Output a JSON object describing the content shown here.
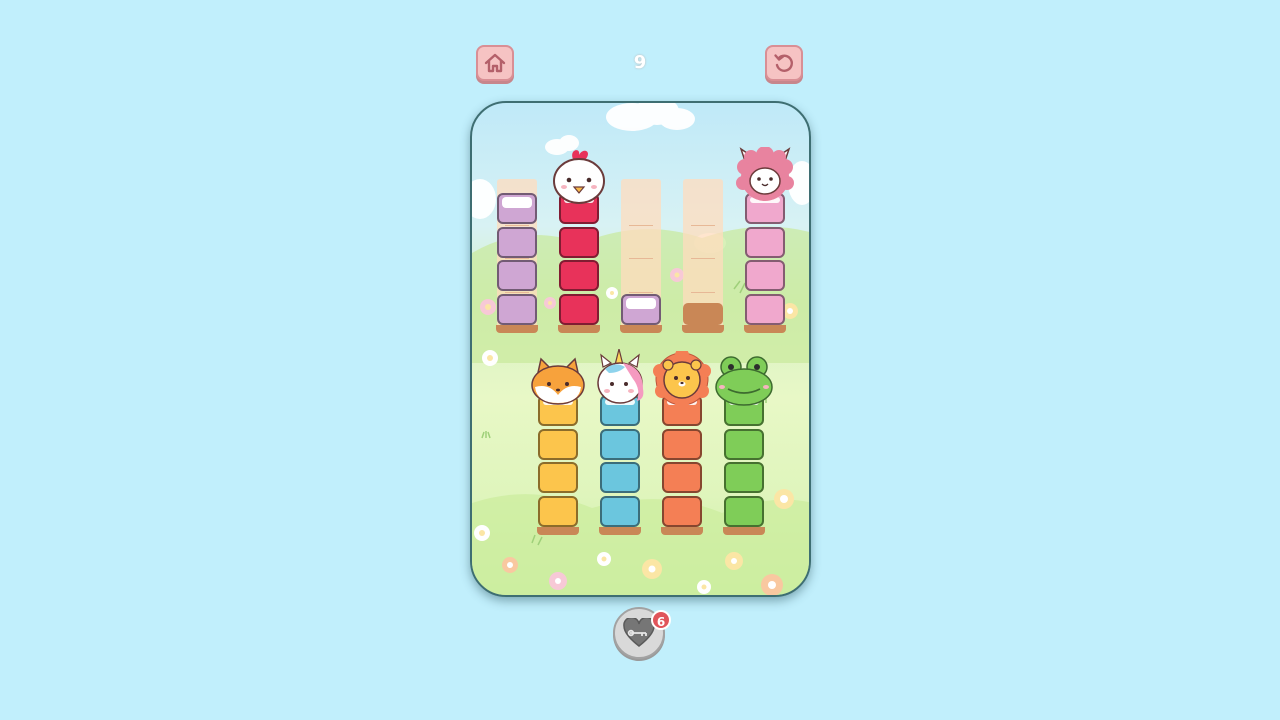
{
  "header": {
    "level_text": "9",
    "home_icon": "home-icon",
    "restart_icon": "restart-icon"
  },
  "board": {
    "background_colors": {
      "sky": "#bfe9f8",
      "grass": "#dff5bc"
    },
    "top_row": [
      {
        "id": "tube-1",
        "capacity": 4,
        "segments": [
          "purple",
          "purple",
          "purple",
          "white-purple"
        ],
        "head": null,
        "complete": false
      },
      {
        "id": "tube-2",
        "capacity": 4,
        "segments": [
          "red",
          "red",
          "red",
          "red"
        ],
        "head": "chicken",
        "complete": true
      },
      {
        "id": "tube-3",
        "capacity": 4,
        "segments": [
          "white-purple"
        ],
        "head": null,
        "complete": false
      },
      {
        "id": "tube-4",
        "capacity": 4,
        "segments": [],
        "head": null,
        "complete": false
      },
      {
        "id": "tube-5",
        "capacity": 4,
        "segments": [
          "pink",
          "pink",
          "pink",
          "pink"
        ],
        "head": "alpaca",
        "complete": true
      }
    ],
    "bottom_row": [
      {
        "id": "tube-6",
        "capacity": 4,
        "segments": [
          "yellow",
          "yellow",
          "yellow",
          "yellow"
        ],
        "head": "fox",
        "complete": true
      },
      {
        "id": "tube-7",
        "capacity": 4,
        "segments": [
          "blue",
          "blue",
          "blue",
          "blue"
        ],
        "head": "unicorn",
        "complete": true
      },
      {
        "id": "tube-8",
        "capacity": 4,
        "segments": [
          "orange",
          "orange",
          "orange",
          "orange"
        ],
        "head": "lion",
        "complete": true
      },
      {
        "id": "tube-9",
        "capacity": 4,
        "segments": [
          "green",
          "green",
          "green",
          "green"
        ],
        "head": "frog",
        "complete": true
      }
    ]
  },
  "colors": {
    "purple": "#cfa6d3",
    "white-purple": "#cfa6d3",
    "red": "#e8325a",
    "pink": "#f0a8cd",
    "yellow": "#fcc54c",
    "blue": "#6bc6de",
    "orange": "#f47f55",
    "green": "#7fcd58"
  },
  "footer": {
    "heart_icon": "broken-heart-key-icon",
    "badge_count": "6"
  }
}
